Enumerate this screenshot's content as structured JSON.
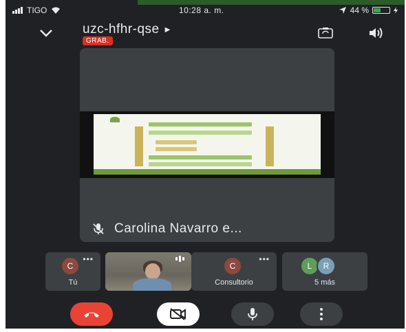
{
  "status_bar": {
    "carrier": "TIGO",
    "time": "10:28 a. m.",
    "battery": "44 %",
    "battery_level": 0.44
  },
  "header": {
    "meeting_code": "uzc-hfhr-qse",
    "recording_badge": "GRAB."
  },
  "main_tile": {
    "presenter_label": "Carolina Navarro e..."
  },
  "participants": [
    {
      "initial": "C",
      "name": "Tú",
      "avatar_color": "#8d4a3c"
    },
    {
      "initial": "C",
      "name": "Consultorio",
      "avatar_color": "#8d4a3c"
    },
    {
      "initials": [
        "L",
        "R"
      ],
      "name": "5 más",
      "avatar_colors": [
        "#5d9e5a",
        "#7aa0b8"
      ]
    }
  ],
  "colors": {
    "background": "#202124",
    "tile": "#3c4043",
    "end_call": "#ea4335",
    "recording": "#d93025"
  },
  "icons": [
    "chevron-down-icon",
    "switch-camera-icon",
    "speaker-icon",
    "mic-off-icon",
    "end-call-icon",
    "camera-off-icon",
    "mic-icon",
    "more-vert-icon"
  ]
}
